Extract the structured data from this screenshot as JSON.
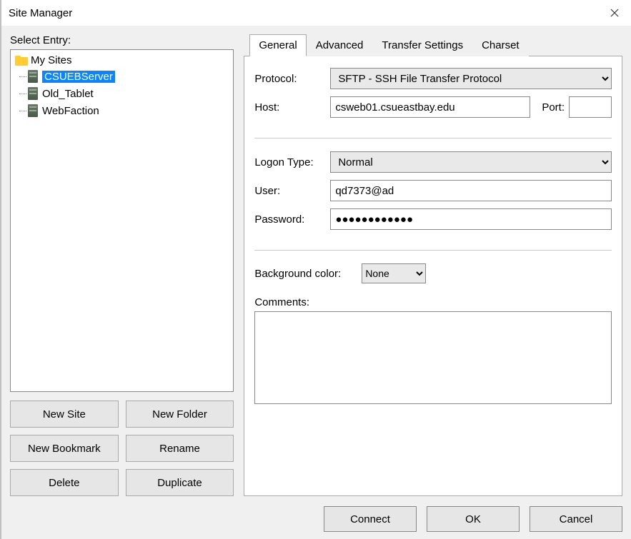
{
  "window": {
    "title": "Site Manager"
  },
  "left": {
    "select_label": "Select Entry:",
    "root_label": "My Sites",
    "sites": [
      {
        "label": "CSUEBServer",
        "selected": true
      },
      {
        "label": "Old_Tablet",
        "selected": false
      },
      {
        "label": "WebFaction",
        "selected": false
      }
    ],
    "buttons": {
      "new_site": "New Site",
      "new_folder": "New Folder",
      "new_bookmark": "New Bookmark",
      "rename": "Rename",
      "delete": "Delete",
      "duplicate": "Duplicate"
    }
  },
  "tabs": {
    "general": "General",
    "advanced": "Advanced",
    "transfer": "Transfer Settings",
    "charset": "Charset",
    "active": "general"
  },
  "general": {
    "protocol_label": "Protocol:",
    "protocol_value": "SFTP - SSH File Transfer Protocol",
    "host_label": "Host:",
    "host_value": "csweb01.csueastbay.edu",
    "port_label": "Port:",
    "port_value": "",
    "logon_label": "Logon Type:",
    "logon_value": "Normal",
    "user_label": "User:",
    "user_value": "qd7373@ad",
    "password_label": "Password:",
    "password_value": "●●●●●●●●●●●●",
    "bgcolor_label": "Background color:",
    "bgcolor_value": "None",
    "comments_label": "Comments:",
    "comments_value": ""
  },
  "footer": {
    "connect": "Connect",
    "ok": "OK",
    "cancel": "Cancel"
  }
}
